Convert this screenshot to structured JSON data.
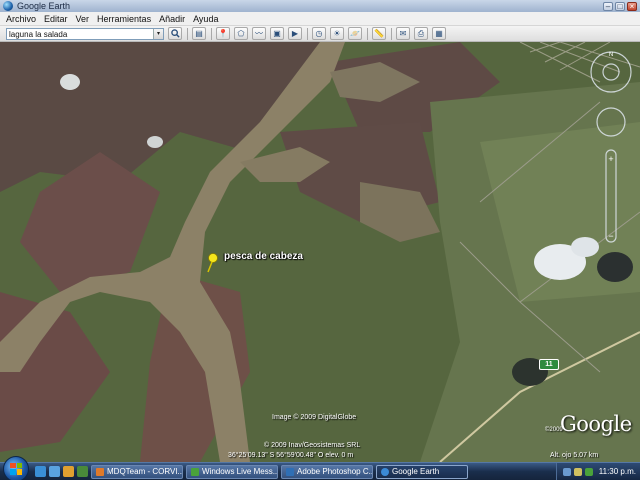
{
  "window": {
    "title": "Google Earth",
    "minimize": "–",
    "maximize": "□",
    "close": "×"
  },
  "menu": [
    "Archivo",
    "Editar",
    "Ver",
    "Herramientas",
    "Añadir",
    "Ayuda"
  ],
  "search": {
    "value": "laguna la salada",
    "dropdown_glyph": "▾"
  },
  "toolbar": {
    "search_btn": "search-icon",
    "buttons": [
      {
        "name": "sidebar-toggle-icon",
        "glyph": "▤"
      },
      {
        "name": "placemark-icon",
        "glyph": "📍"
      },
      {
        "name": "polygon-icon",
        "glyph": "⬠"
      },
      {
        "name": "path-icon",
        "glyph": "〰"
      },
      {
        "name": "image-overlay-icon",
        "glyph": "▣"
      },
      {
        "name": "tour-icon",
        "glyph": "▶"
      },
      {
        "name": "history-clock-icon",
        "glyph": "◷"
      },
      {
        "name": "sunlight-icon",
        "glyph": "☀"
      },
      {
        "name": "planet-icon",
        "glyph": "🪐"
      },
      {
        "name": "ruler-icon",
        "glyph": "📏"
      },
      {
        "name": "email-icon",
        "glyph": "✉"
      },
      {
        "name": "print-icon",
        "glyph": "⎙"
      },
      {
        "name": "view-in-maps-icon",
        "glyph": "▦"
      }
    ]
  },
  "map": {
    "placemark_label": "pesca de cabeza",
    "image_credit": "Image © 2009 DigitalGlobe",
    "copyright": "© 2009 Inav/Geosistemas SRL",
    "coordinates": "36°25'09.13\" S    56°59'00.48\" O    elev.    0 m",
    "logo": "Google",
    "map_copyright": "©2009",
    "altitude": "Alt. ojo    5.07 km",
    "road_shield": "11"
  },
  "taskbar": {
    "items": [
      {
        "label": "MDQTeam - CORVI...",
        "color": "#e07a2a"
      },
      {
        "label": "Windows Live Mess...",
        "color": "#4aa23a"
      },
      {
        "label": "Adobe Photoshop C...",
        "color": "#2f6fb5"
      },
      {
        "label": "Google Earth",
        "color": "#3b8ad6",
        "active": true
      }
    ],
    "clock": "11:30 p.m."
  }
}
